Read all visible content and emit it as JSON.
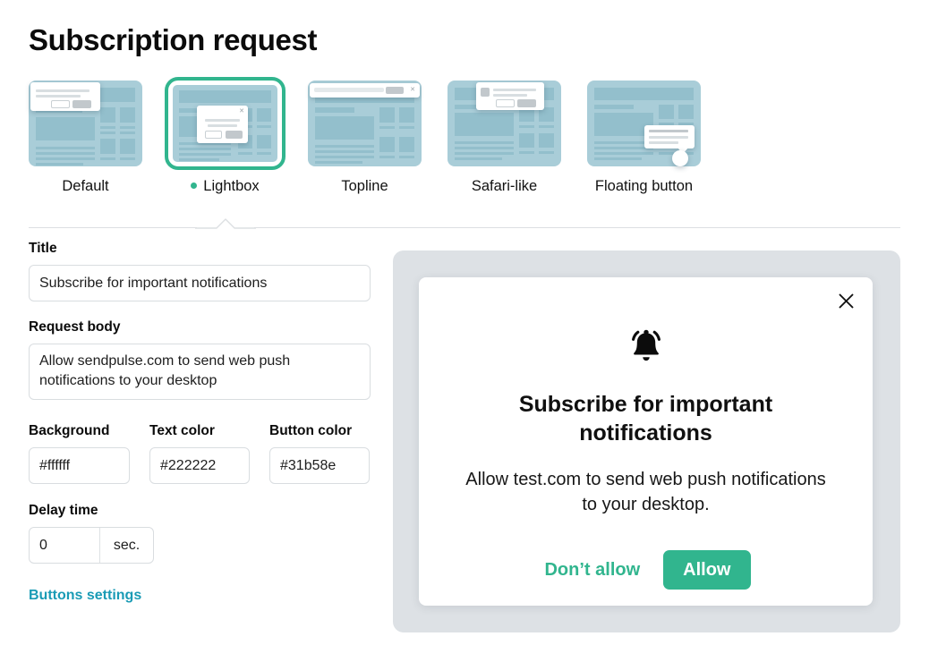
{
  "header": {
    "title": "Subscription request"
  },
  "templates": {
    "selected_index": 1,
    "items": [
      {
        "label": "Default",
        "icon": "template-default-thumbnail"
      },
      {
        "label": "Lightbox",
        "icon": "template-lightbox-thumbnail"
      },
      {
        "label": "Topline",
        "icon": "template-topline-thumbnail"
      },
      {
        "label": "Safari-like",
        "icon": "template-safari-like-thumbnail"
      },
      {
        "label": "Floating button",
        "icon": "template-floating-button-thumbnail"
      }
    ]
  },
  "form": {
    "title_label": "Title",
    "title_value": "Subscribe for important notifications",
    "title_placeholder": "Subscribe for important notifications",
    "body_label": "Request body",
    "body_value": "Allow sendpulse.com to send web push notifications to your desktop",
    "body_placeholder": "Allow sendpulse.com to send web push notifications to your desktop",
    "background_label": "Background",
    "background_value": "#ffffff",
    "text_color_label": "Text color",
    "text_color_value": "#222222",
    "button_color_label": "Button color",
    "button_color_value": "#31b58e",
    "delay_label": "Delay time",
    "delay_value": "0",
    "delay_unit": "sec.",
    "buttons_settings_link": "Buttons settings"
  },
  "preview": {
    "close_icon": "close-icon",
    "bell_icon": "bell-icon",
    "title": "Subscribe for important notifications",
    "body": "Allow test.com to send web push notifications to your desktop.",
    "deny_label": "Don’t allow",
    "allow_label": "Allow"
  },
  "colors": {
    "accent_green": "#31b58e",
    "link_teal": "#1a9bb5",
    "panel_gray": "#dde1e5",
    "thumb_bg": "#a9cdd8",
    "thumb_fg": "#93bfcc",
    "divider": "#dcdfe2"
  }
}
